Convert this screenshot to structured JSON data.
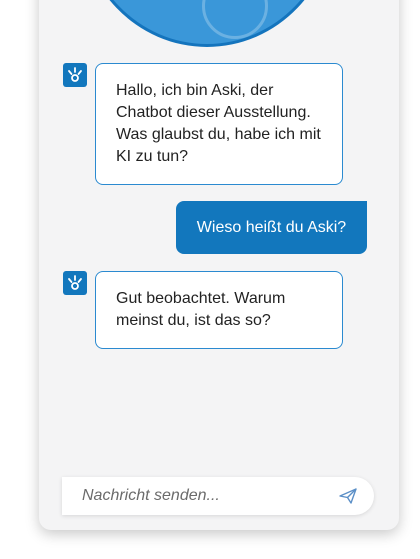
{
  "chat": {
    "messages": [
      {
        "role": "bot",
        "text": "Hallo, ich bin Aski, der Chatbot dieser Ausstellung. Was glaubst du, habe ich mit KI zu tun?"
      },
      {
        "role": "user",
        "text": "Wieso heißt du Aski?"
      },
      {
        "role": "bot",
        "text": "Gut beobachtet. Warum meinst du, ist das so?"
      }
    ]
  },
  "composer": {
    "placeholder": "Nachricht senden...",
    "value": "",
    "send_icon": "paper-plane-icon"
  },
  "bot_avatar_icon": "aski-bot-icon",
  "colors": {
    "accent": "#1277bd",
    "bubble_border": "#2b8ad0",
    "header": "#3a97d9",
    "panel_bg": "#f4f4f5"
  }
}
